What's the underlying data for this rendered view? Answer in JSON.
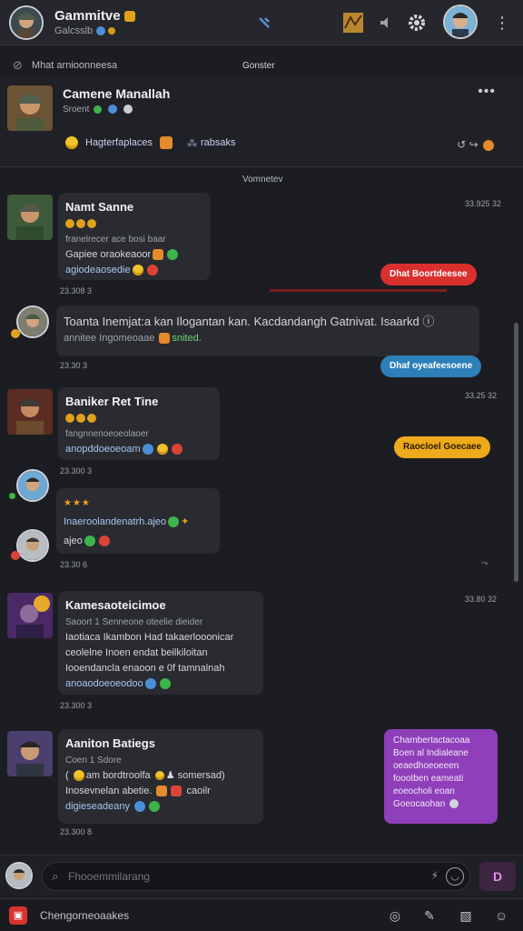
{
  "app": {
    "title": "Gammitve",
    "subtitle": "Galcsslb"
  },
  "channel": {
    "meta_left": "Mhat arnioonneesa",
    "meta_center": "Gonster",
    "name": "Camene Manallah",
    "status": "Sroent",
    "tags_label": "Hagterfaplaces",
    "tags_label2": "rabsaks"
  },
  "feed": {
    "day_separator": "Vomnetev",
    "messages": [
      {
        "name": "Namt Sanne",
        "line1": "franelrecer ace bosi baar",
        "line2": "Gapiee oraokeaoor",
        "line3": "agiodeaosedie",
        "time": "23.308 3",
        "side_time": "33.925 32"
      },
      {
        "line1": "Toanta Inemjat:a kan Ilogantan kan. Kacdandangh Gatnivat. Isaarkd",
        "line2": "annitee Ingomeoaae",
        "line2_tag": "snited.",
        "time": "23.30 3"
      },
      {
        "name": "Baniker Ret Tine",
        "line1": "fangnnenoeoeolaoer",
        "line2": "anopddoeoeoam",
        "time": "23.300 3",
        "side_time": "33.25 32"
      },
      {
        "line1": "Inaeroolandenatrh.ajeo",
        "line2": "ajeo",
        "time": "23.30 6"
      },
      {
        "name": "Kamesaoteicimoe",
        "line0": "Saoort 1 Senneone oteelie dieider",
        "line1": "Iaotiaca Ikambon Had takaerlooonicar",
        "line2": "ceolelne Inoen endat beilkiloitan",
        "line3": "Iooendancla enaoon e 0f tamnalnah",
        "line4": "anoaodoeoeodoo",
        "time": "23.300 3",
        "side_time": "33.80 32"
      },
      {
        "name": "Aaniton Batiegs",
        "line0": "Coen 1 Sdore",
        "line1": "am bordtroolfa",
        "line1b": "somersad",
        "line2": "Inosevnelan abetie.",
        "line2b": "caoilr",
        "line3": "digieseadeany",
        "time": "23.300 8"
      }
    ],
    "pills": [
      {
        "text": "Dhat Boortdeesee",
        "color": "#d9302e"
      },
      {
        "text": "Dhaf oyeafeesoene",
        "color": "#2d7fb8"
      },
      {
        "text": "Raocloel Goecaee",
        "color": "#ecaa1c"
      }
    ],
    "purple_card": {
      "lines": [
        "Chambertactacoaa",
        "Boen al Indialeane",
        "oeaedhoeoeeen",
        "foootben eameati",
        "eoeocholi eoan",
        "Goeocaohan"
      ]
    }
  },
  "composer": {
    "placeholder": "Fhooemmilarang",
    "send_label": "D"
  },
  "bottom": {
    "label": "Chengorneoaakes"
  },
  "colors": {
    "background": "#1c1d22",
    "bubble": "#2a2b31",
    "accent_purple": "#8f3fb9",
    "accent_red": "#d9302e",
    "accent_blue": "#2d7fb8",
    "accent_amber": "#ecaa1c"
  },
  "icons": {
    "top": [
      "app-avatar",
      "crown-badge-icon",
      "pin-icon",
      "map-icon",
      "mute-icon",
      "gear-icon",
      "user-avatar",
      "more-vertical-icon"
    ],
    "bottom": [
      "browser-icon",
      "pen-icon",
      "image-icon",
      "emoji-icon"
    ]
  }
}
